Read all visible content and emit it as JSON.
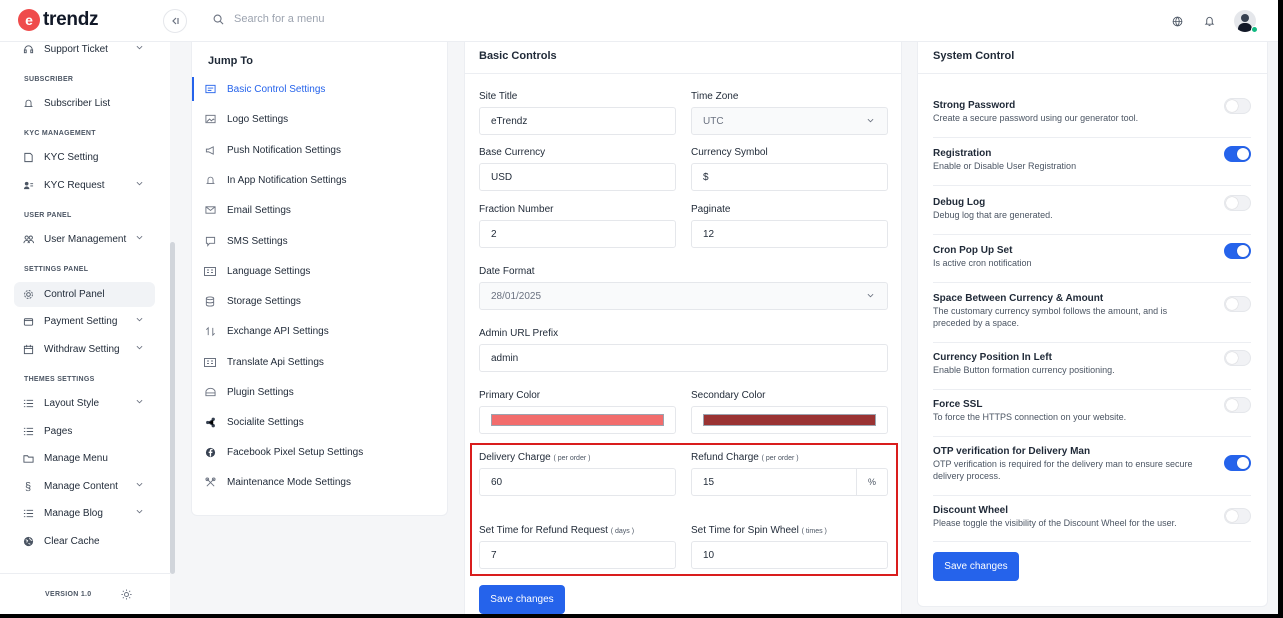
{
  "brand": {
    "mark": "e",
    "name": "trendz"
  },
  "header": {
    "search_placeholder": "Search for a menu",
    "collapse_icon": "collapse-sidebar-icon"
  },
  "sidebar": {
    "items_top": [
      {
        "label": "Support Ticket",
        "icon": "headset-icon",
        "has_children": true
      }
    ],
    "sections": [
      {
        "title": "SUBSCRIBER",
        "items": [
          {
            "label": "Subscriber List",
            "icon": "bell-icon"
          }
        ]
      },
      {
        "title": "KYC MANAGEMENT",
        "items": [
          {
            "label": "KYC Setting",
            "icon": "file-icon"
          },
          {
            "label": "KYC Request",
            "icon": "user-list-icon",
            "has_children": true
          }
        ]
      },
      {
        "title": "USER PANEL",
        "items": [
          {
            "label": "User Management",
            "icon": "users-icon",
            "has_children": true
          }
        ]
      },
      {
        "title": "SETTINGS PANEL",
        "items": [
          {
            "label": "Control Panel",
            "icon": "gear-icon",
            "active": true
          },
          {
            "label": "Payment Setting",
            "icon": "wallet-icon",
            "has_children": true
          },
          {
            "label": "Withdraw Setting",
            "icon": "calendar-icon",
            "has_children": true
          }
        ]
      },
      {
        "title": "THEMES SETTINGS",
        "items": [
          {
            "label": "Layout Style",
            "icon": "list-icon",
            "has_children": true
          },
          {
            "label": "Pages",
            "icon": "list-icon"
          },
          {
            "label": "Manage Menu",
            "icon": "folder-icon"
          },
          {
            "label": "Manage Content",
            "icon": "section-icon",
            "has_children": true
          },
          {
            "label": "Manage Blog",
            "icon": "list-icon",
            "has_children": true
          },
          {
            "label": "Clear Cache",
            "icon": "globe-icon"
          }
        ]
      }
    ],
    "version": "VERSION 1.0"
  },
  "jump_to": {
    "title": "Jump To",
    "items": [
      {
        "label": "Basic Control Settings",
        "icon": "sliders-icon",
        "active": true
      },
      {
        "label": "Logo Settings",
        "icon": "image-icon"
      },
      {
        "label": "Push Notification Settings",
        "icon": "megaphone-icon"
      },
      {
        "label": "In App Notification Settings",
        "icon": "bell-icon"
      },
      {
        "label": "Email Settings",
        "icon": "mail-icon"
      },
      {
        "label": "SMS Settings",
        "icon": "chat-icon"
      },
      {
        "label": "Language Settings",
        "icon": "language-icon"
      },
      {
        "label": "Storage Settings",
        "icon": "database-icon"
      },
      {
        "label": "Exchange API Settings",
        "icon": "exchange-icon"
      },
      {
        "label": "Translate Api Settings",
        "icon": "translate-icon"
      },
      {
        "label": "Plugin Settings",
        "icon": "plugin-icon"
      },
      {
        "label": "Socialite Settings",
        "icon": "share-icon"
      },
      {
        "label": "Facebook Pixel Setup Settings",
        "icon": "facebook-icon"
      },
      {
        "label": "Maintenance Mode Settings",
        "icon": "tools-icon"
      }
    ]
  },
  "basic": {
    "title": "Basic Controls",
    "site_title": {
      "label": "Site Title",
      "value": "eTrendz"
    },
    "time_zone": {
      "label": "Time Zone",
      "value": "UTC"
    },
    "base_currency": {
      "label": "Base Currency",
      "value": "USD"
    },
    "currency_symbol": {
      "label": "Currency Symbol",
      "value": "$"
    },
    "fraction_number": {
      "label": "Fraction Number",
      "value": "2"
    },
    "paginate": {
      "label": "Paginate",
      "value": "12"
    },
    "date_format": {
      "label": "Date Format",
      "value": "28/01/2025"
    },
    "admin_prefix": {
      "label": "Admin URL Prefix",
      "value": "admin"
    },
    "primary_color": {
      "label": "Primary Color",
      "value": "#f26c6c"
    },
    "secondary_color": {
      "label": "Secondary Color",
      "value": "#9a3333"
    },
    "delivery_charge": {
      "label": "Delivery Charge",
      "hint": "( per order )",
      "value": "60"
    },
    "refund_charge": {
      "label": "Refund Charge",
      "hint": "( per order )",
      "value": "15",
      "unit": "%"
    },
    "refund_time": {
      "label": "Set Time for Refund Request",
      "hint": "( days )",
      "value": "7"
    },
    "spin_time": {
      "label": "Set Time for Spin Wheel",
      "hint": "( times )",
      "value": "10"
    },
    "save": "Save changes"
  },
  "system": {
    "title": "System Control",
    "rows": [
      {
        "title": "Strong Password",
        "desc": "Create a secure password using our generator tool.",
        "on": false
      },
      {
        "title": "Registration",
        "desc": "Enable or Disable User Registration",
        "on": true
      },
      {
        "title": "Debug Log",
        "desc": "Debug log that are generated.",
        "on": false
      },
      {
        "title": "Cron Pop Up Set",
        "desc": "Is active cron notification",
        "on": true
      },
      {
        "title": "Space Between Currency & Amount",
        "desc": "The customary currency symbol follows the amount, and is preceded by a space.",
        "on": false
      },
      {
        "title": "Currency Position In Left",
        "desc": "Enable Button formation currency positioning.",
        "on": false
      },
      {
        "title": "Force SSL",
        "desc": "To force the HTTPS connection on your website.",
        "on": false
      },
      {
        "title": "OTP verification for Delivery Man",
        "desc": "OTP verification is required for the delivery man to ensure secure delivery process.",
        "on": true
      },
      {
        "title": "Discount Wheel",
        "desc": "Please toggle the visibility of the Discount Wheel for the user.",
        "on": false
      }
    ],
    "save": "Save changes"
  },
  "colors": {
    "accent": "#2563eb",
    "highlight": "#d91d1d",
    "brand": "#ef4b4b"
  }
}
